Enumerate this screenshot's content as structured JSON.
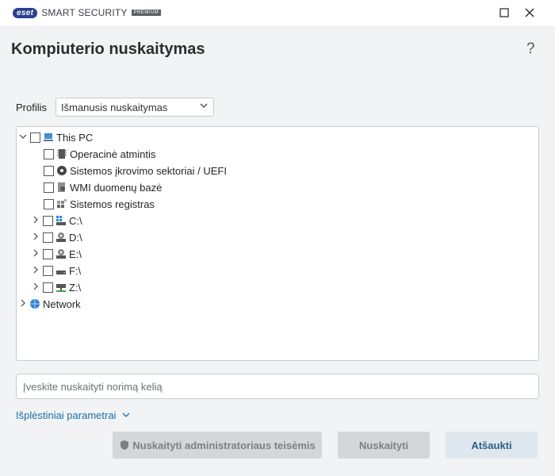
{
  "app": {
    "brand": "eset",
    "product": "SMART SECURITY",
    "edition": "PREMIUM"
  },
  "window": {
    "minimize_icon": "minimize-icon",
    "close_icon": "close-icon"
  },
  "header": {
    "title": "Kompiuterio nuskaitymas",
    "help": "?"
  },
  "profile": {
    "label": "Profilis",
    "selected": "Išmanusis nuskaitymas"
  },
  "tree": {
    "root": {
      "label": "This PC",
      "icon": "computer-icon"
    },
    "items": [
      {
        "label": "Operacinė atmintis",
        "icon": "memory-icon"
      },
      {
        "label": "Sistemos įkrovimo sektoriai / UEFI",
        "icon": "disc-icon"
      },
      {
        "label": "WMI duomenų bazė",
        "icon": "database-icon"
      },
      {
        "label": "Sistemos registras",
        "icon": "registry-icon"
      },
      {
        "label": "C:\\",
        "icon": "system-drive-icon"
      },
      {
        "label": "D:\\",
        "icon": "optical-drive-icon"
      },
      {
        "label": "E:\\",
        "icon": "optical-drive-icon"
      },
      {
        "label": "F:\\",
        "icon": "drive-icon"
      },
      {
        "label": "Z:\\",
        "icon": "network-drive-icon"
      }
    ],
    "network": {
      "label": "Network",
      "icon": "network-icon"
    }
  },
  "path_input": {
    "placeholder": "Įveskite nuskaityti norimą kelią",
    "value": ""
  },
  "advanced": {
    "label": "Išplėstiniai parametrai"
  },
  "buttons": {
    "admin": "Nuskaityti administratoriaus teisėmis",
    "scan": "Nuskaityti",
    "cancel": "Atšaukti"
  },
  "colors": {
    "accent": "#1b6fad",
    "brand": "#2a3f8f",
    "disabled_button": "#d4d6d8"
  }
}
